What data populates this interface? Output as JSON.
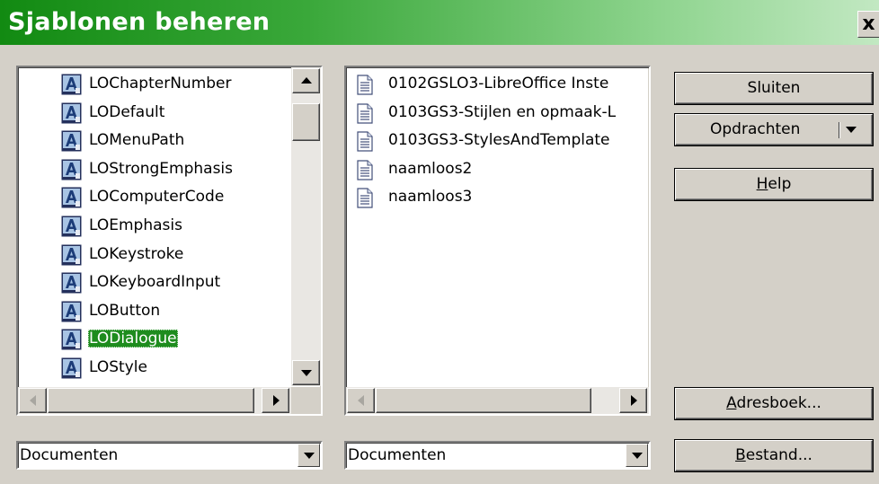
{
  "window": {
    "title": "Sjablonen beheren",
    "close_label": "x"
  },
  "left_list": {
    "items": [
      {
        "label": "LOChapterNumber",
        "icon": "paragraph-style-icon"
      },
      {
        "label": "LODefault",
        "icon": "paragraph-style-icon"
      },
      {
        "label": "LOMenuPath",
        "icon": "paragraph-style-icon"
      },
      {
        "label": "LOStrongEmphasis",
        "icon": "paragraph-style-icon"
      },
      {
        "label": "LOComputerCode",
        "icon": "paragraph-style-icon"
      },
      {
        "label": "LOEmphasis",
        "icon": "paragraph-style-icon"
      },
      {
        "label": "LOKeystroke",
        "icon": "paragraph-style-icon"
      },
      {
        "label": "LOKeyboardInput",
        "icon": "paragraph-style-icon"
      },
      {
        "label": "LOButton",
        "icon": "paragraph-style-icon"
      },
      {
        "label": "LODialogue",
        "icon": "paragraph-style-icon",
        "selected": true
      },
      {
        "label": "LOStyle",
        "icon": "paragraph-style-icon"
      }
    ],
    "selected_index": 9
  },
  "middle_list": {
    "items": [
      {
        "label": "0102GSLO3-LibreOffice Inste",
        "icon": "document-icon"
      },
      {
        "label": "0103GS3-Stijlen en opmaak-L",
        "icon": "document-icon"
      },
      {
        "label": "0103GS3-StylesAndTemplate",
        "icon": "document-icon"
      },
      {
        "label": "naamloos2",
        "icon": "document-icon"
      },
      {
        "label": "naamloos3",
        "icon": "document-icon"
      }
    ]
  },
  "buttons": {
    "close": "Sluiten",
    "commands": "Opdrachten",
    "help": "Help",
    "help_mnemonic": "H",
    "help_rest": "elp",
    "address_book": "Adresboek...",
    "address_mnemonic": "A",
    "address_rest": "dresboek...",
    "file": "Bestand...",
    "file_mnemonic": "B",
    "file_rest": "estand..."
  },
  "combos": {
    "left_value": "Documenten",
    "middle_value": "Documenten"
  },
  "colors": {
    "titlebar_start": "#128a12",
    "selection": "#1e8c1e",
    "dialog_bg": "#d4d0c8"
  }
}
